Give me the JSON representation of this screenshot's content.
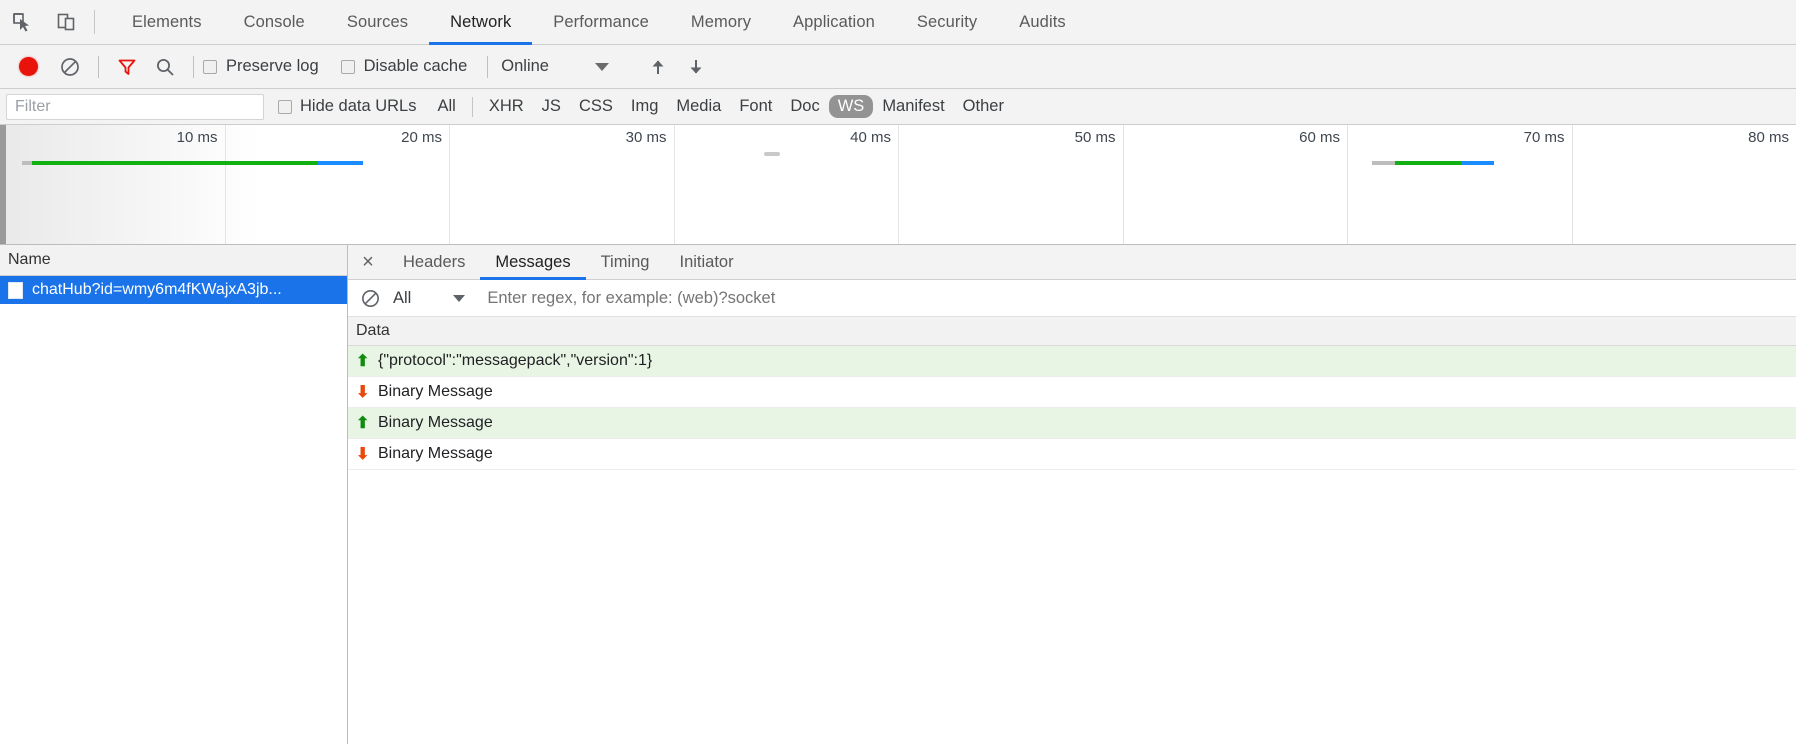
{
  "devtools": {
    "icons": {
      "inspect": "inspect-element-icon",
      "device": "device-toolbar-icon"
    },
    "tabs": [
      {
        "label": "Elements",
        "active": false
      },
      {
        "label": "Console",
        "active": false
      },
      {
        "label": "Sources",
        "active": false
      },
      {
        "label": "Network",
        "active": true
      },
      {
        "label": "Performance",
        "active": false
      },
      {
        "label": "Memory",
        "active": false
      },
      {
        "label": "Application",
        "active": false
      },
      {
        "label": "Security",
        "active": false
      },
      {
        "label": "Audits",
        "active": false
      }
    ]
  },
  "toolbar": {
    "record_title": "record-button",
    "clear_title": "clear-button",
    "filter_title": "filter-icon",
    "search_title": "search-icon",
    "preserve_log_label": "Preserve log",
    "preserve_log_checked": false,
    "disable_cache_label": "Disable cache",
    "disable_cache_checked": false,
    "throttle_value": "Online",
    "import_title": "import-har-icon",
    "export_title": "export-har-icon",
    "accent_red": "#e8140c"
  },
  "filterbar": {
    "filter_placeholder": "Filter",
    "hide_data_urls_label": "Hide data URLs",
    "hide_data_urls_checked": false,
    "types": [
      {
        "label": "All",
        "selected": false
      },
      {
        "label": "XHR",
        "selected": false
      },
      {
        "label": "JS",
        "selected": false
      },
      {
        "label": "CSS",
        "selected": false
      },
      {
        "label": "Img",
        "selected": false
      },
      {
        "label": "Media",
        "selected": false
      },
      {
        "label": "Font",
        "selected": false
      },
      {
        "label": "Doc",
        "selected": false
      },
      {
        "label": "WS",
        "selected": true
      },
      {
        "label": "Manifest",
        "selected": false
      },
      {
        "label": "Other",
        "selected": false
      }
    ],
    "selected_type": "WS"
  },
  "overview": {
    "ticks": [
      "10 ms",
      "20 ms",
      "30 ms",
      "40 ms",
      "50 ms",
      "60 ms",
      "70 ms",
      "80 ms"
    ],
    "requests": [
      {
        "left_pct": 1.2,
        "segments": [
          {
            "color": "#bdbdbd",
            "left_pct": 0.0,
            "width_pct": 0.5
          },
          {
            "color": "#12b012",
            "left_pct": 0.5,
            "width_pct": 16.0
          },
          {
            "color": "#1a8cff",
            "left_pct": 16.5,
            "width_pct": 2.3
          }
        ]
      },
      {
        "left_pct": 76.4,
        "segments": [
          {
            "color": "#bdbdbd",
            "left_pct": 0.0,
            "width_pct": 1.3
          },
          {
            "color": "#12b012",
            "left_pct": 1.3,
            "width_pct": 3.6
          },
          {
            "color": "#1a8cff",
            "left_pct": 4.9,
            "width_pct": 1.8
          }
        ]
      }
    ]
  },
  "requests": {
    "column_header": "Name",
    "rows": [
      {
        "name": "chatHub?id=wmy6m4fKWajxA3jb...",
        "selected": true,
        "icon": "document-icon"
      }
    ]
  },
  "detail": {
    "close_label": "×",
    "tabs": [
      {
        "label": "Headers",
        "active": false
      },
      {
        "label": "Messages",
        "active": true
      },
      {
        "label": "Timing",
        "active": false
      },
      {
        "label": "Initiator",
        "active": false
      }
    ],
    "message_filter": {
      "clear_icon": "clear-filter-icon",
      "type_value": "All",
      "regex_placeholder": "Enter regex, for example: (web)?socket",
      "regex_value": ""
    },
    "data_column_header": "Data",
    "messages": [
      {
        "direction": "sent",
        "arrow": "⬆",
        "text": "{\"protocol\":\"messagepack\",\"version\":1}"
      },
      {
        "direction": "received",
        "arrow": "⬇",
        "text": "Binary Message"
      },
      {
        "direction": "sent",
        "arrow": "⬆",
        "text": "Binary Message"
      },
      {
        "direction": "received",
        "arrow": "⬇",
        "text": "Binary Message"
      }
    ],
    "colors": {
      "sent_bg": "#e8f5e4",
      "sent_arrow": "#108b10",
      "received_arrow": "#e8490c",
      "accent": "#1a73e8"
    }
  }
}
